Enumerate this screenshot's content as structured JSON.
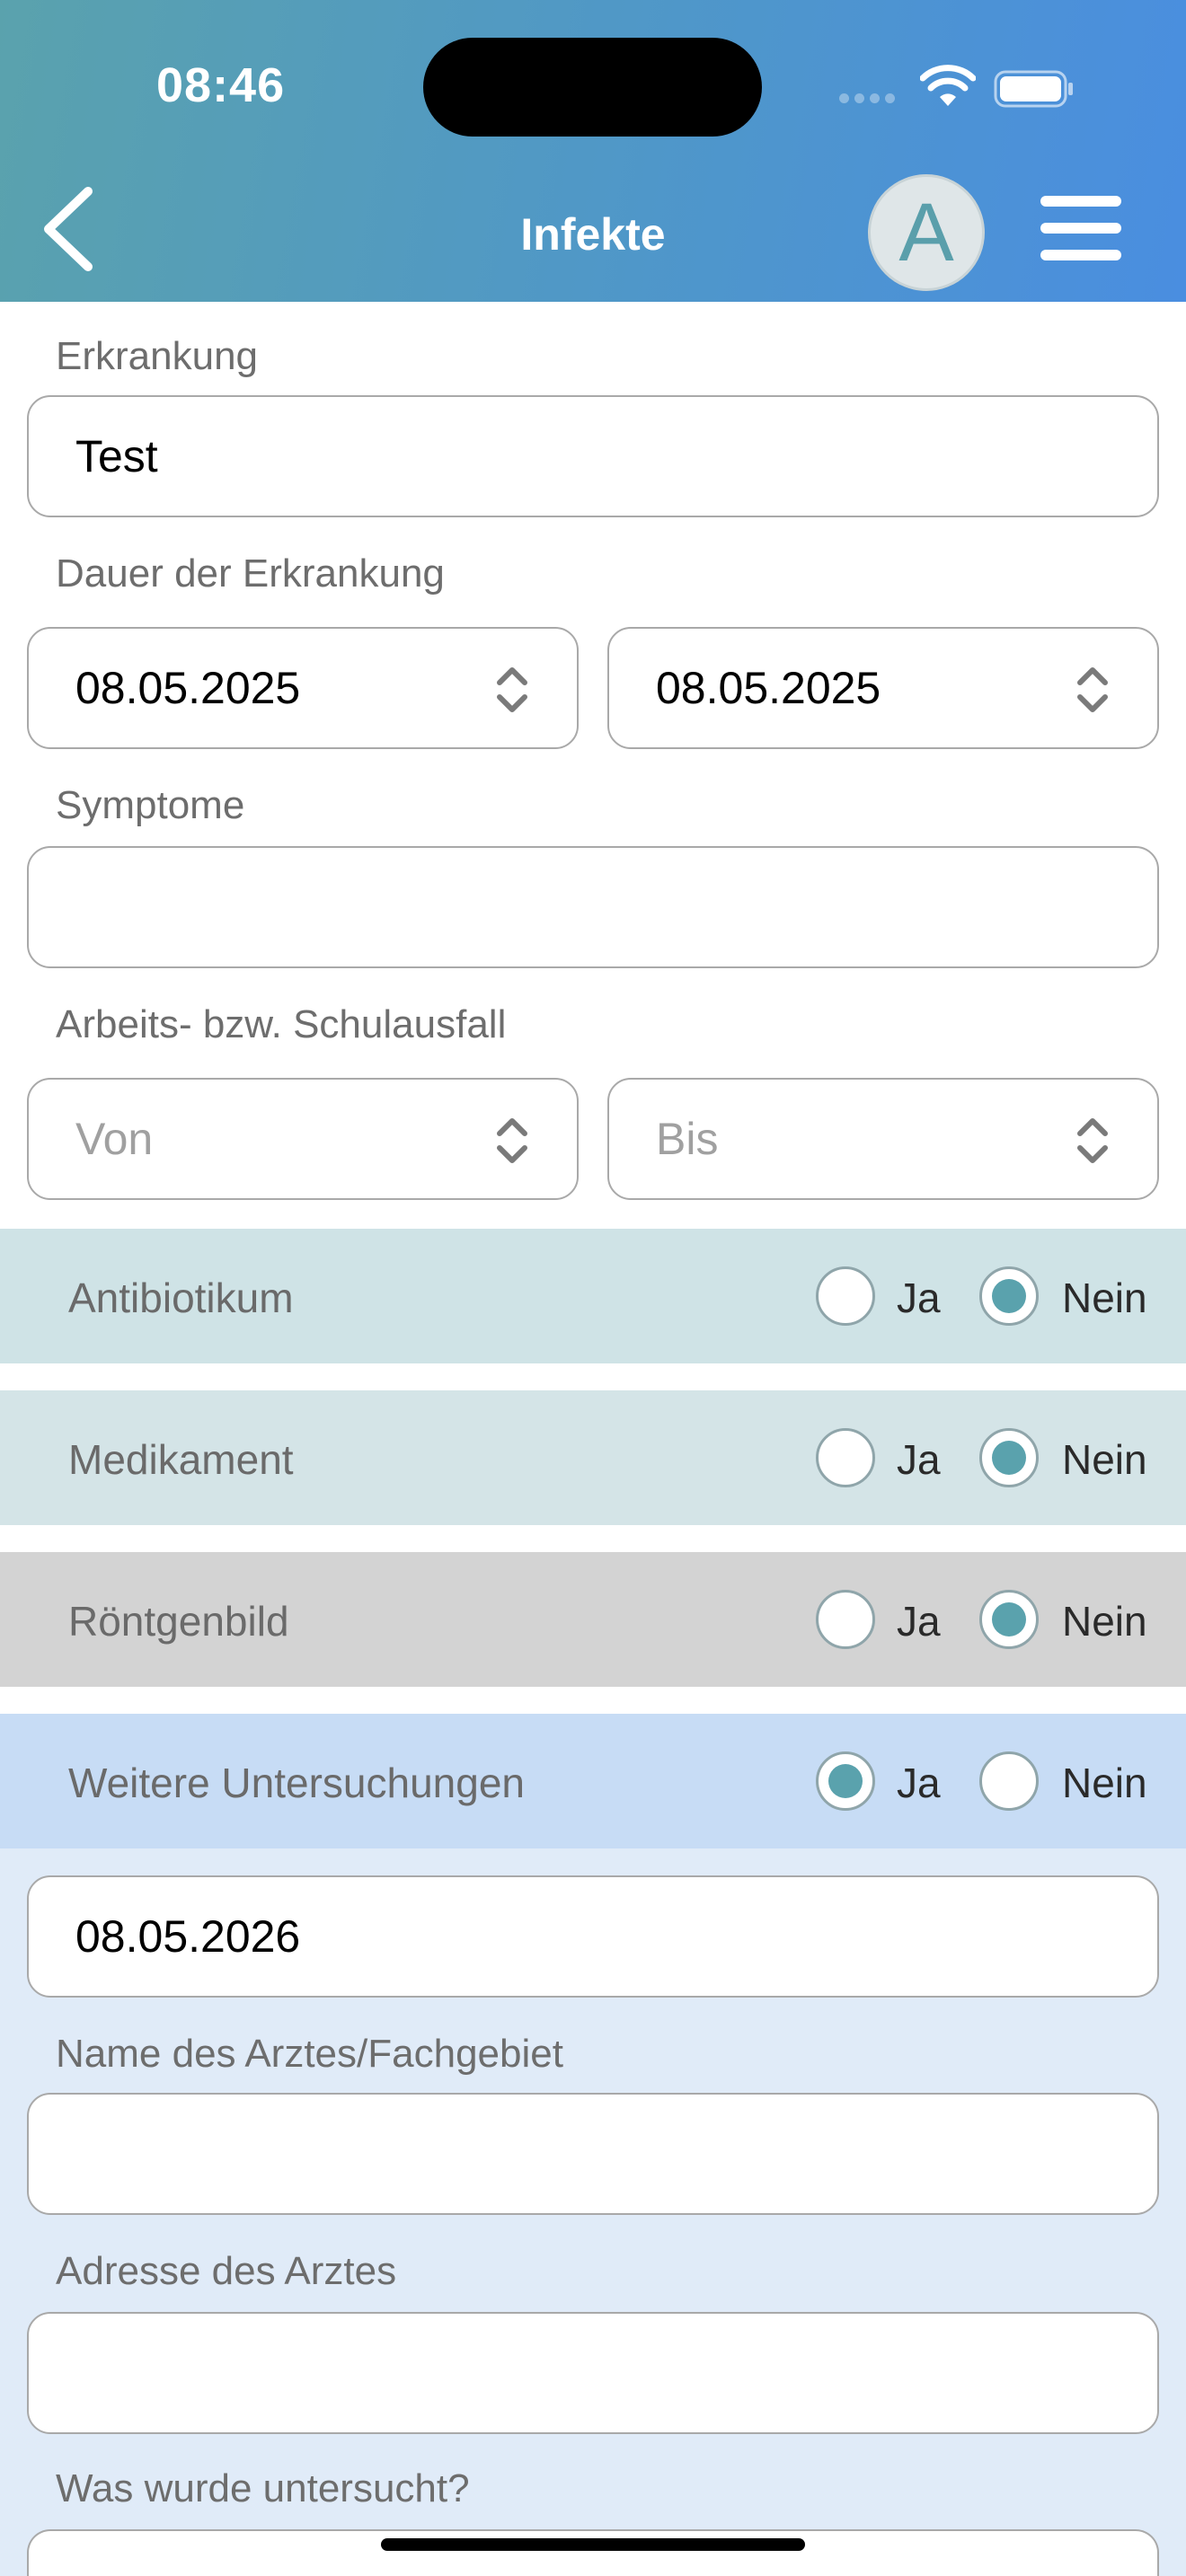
{
  "status_bar": {
    "time": "08:46"
  },
  "nav": {
    "title": "Infekte",
    "avatar_letter": "A"
  },
  "form": {
    "erkrankung": {
      "label": "Erkrankung",
      "value": "Test"
    },
    "dauer": {
      "label": "Dauer der Erkrankung",
      "from": "08.05.2025",
      "to": "08.05.2025"
    },
    "symptome": {
      "label": "Symptome",
      "value": ""
    },
    "ausfall": {
      "label": "Arbeits- bzw. Schulausfall",
      "from_placeholder": "Von",
      "to_placeholder": "Bis"
    },
    "questions": [
      {
        "label": "Antibiotikum",
        "yes": "Ja",
        "no": "Nein",
        "selected": "Nein",
        "bg": "#cfe3e6"
      },
      {
        "label": "Medikament",
        "yes": "Ja",
        "no": "Nein",
        "selected": "Nein",
        "bg": "#d4e4e7"
      },
      {
        "label": "Röntgenbild",
        "yes": "Ja",
        "no": "Nein",
        "selected": "Nein",
        "bg": "#d3d3d3"
      },
      {
        "label": "Weitere Untersuchungen",
        "yes": "Ja",
        "no": "Nein",
        "selected": "Ja",
        "bg": "#c7dcf5"
      }
    ],
    "untersuchung_datum": {
      "value": "08.05.2026"
    },
    "arzt_name": {
      "label": "Name des Arztes/Fachgebiet",
      "value": ""
    },
    "arzt_adresse": {
      "label": "Adresse des Arztes",
      "value": ""
    },
    "untersucht": {
      "label": "Was wurde untersucht?",
      "value": ""
    }
  },
  "colors": {
    "accent": "#5aa2ad",
    "header_start": "#5aa2ad",
    "header_end": "#4a8ee0"
  }
}
